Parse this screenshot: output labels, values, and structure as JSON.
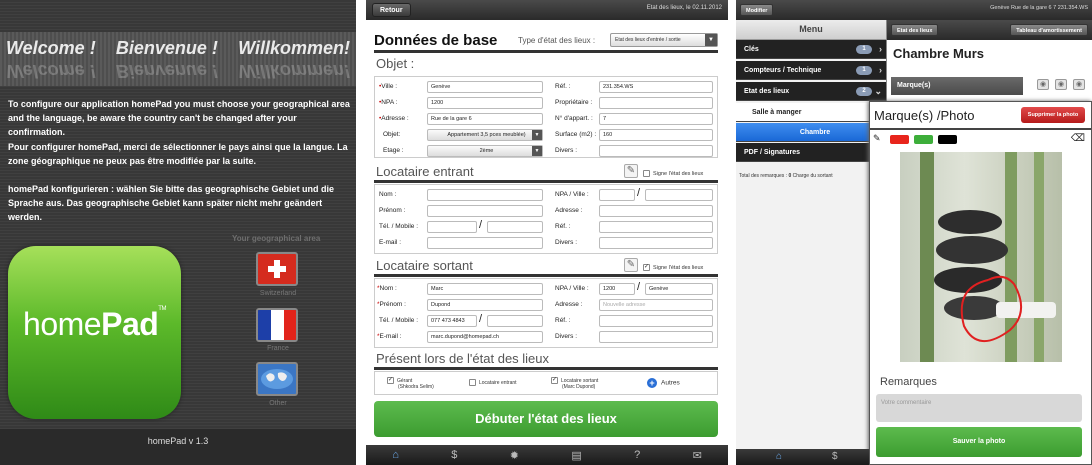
{
  "screen1": {
    "welcome": [
      "Welcome !",
      "Bienvenue !",
      "Willkommen!"
    ],
    "intro_en": "To configure our application homePad you must choose your geographical area and the language, be aware the country can't be changed after your confirmation.",
    "intro_fr": "Pour configurer homePad, merci de sélectionner le pays ainsi que la langue. La zone géographique ne peux pas être modifiée par la suite.",
    "intro_de": "homePad konfigurieren : wählen Sie bitte das geographische Gebiet und die Sprache aus. Das geographische Gebiet kann später nicht mehr geändert werden.",
    "geo_title": "Your geographical area",
    "logo": {
      "home": "home",
      "pad": "Pad",
      "tm": "TM"
    },
    "countries": [
      {
        "label": "Switzerland",
        "icon": "swiss-flag-icon"
      },
      {
        "label": "France",
        "icon": "french-flag-icon"
      },
      {
        "label": "Other",
        "icon": "world-map-icon"
      }
    ],
    "version": "homePad v 1.3"
  },
  "screen2": {
    "back": "Retour",
    "header_right": "Etat des lieux, le 02.11.2012",
    "title": "Données de base",
    "type_label": "Type d'état des lieux :",
    "type_value": "Etat des lieux d'entrée / sortie",
    "objet_title": "Objet :",
    "objet": {
      "ville_label": "Ville :",
      "ville": "Genève",
      "ref_label": "Réf. :",
      "ref": "231.354.WS",
      "npa_label": "NPA :",
      "npa": "1200",
      "proprio_label": "Propriétaire :",
      "proprio": "",
      "adresse_label": "Adresse :",
      "adresse": "Rue de la gare 6",
      "appart_label": "N° d'appart. :",
      "appart": "7",
      "objet_label": "Objet:",
      "objet": "Appartement 3,5 pces meublée)",
      "surface_label": "Surface (m2) :",
      "surface": "160",
      "etage_label": "Etage :",
      "etage": "2ème",
      "divers_label": "Divers :",
      "divers": ""
    },
    "entrant_title": "Locataire entrant",
    "sign_label": "Signe l'état des lieux",
    "fields_left": [
      "Nom :",
      "Prénom :",
      "Tél. / Mobile :",
      "E-mail :"
    ],
    "fields_right": [
      "NPA / Ville :",
      "Adresse :",
      "Réf. :",
      "Divers :"
    ],
    "sortant_title": "Locataire sortant",
    "sortant": {
      "nom": "Marc",
      "prenom": "Dupond",
      "tel": "077 473 4843",
      "email": "marc.dupond@homepad.ch",
      "npa": "1200",
      "ville": "Genève",
      "adresse_ph": "Nouvelle adresse"
    },
    "present_title": "Présent lors de l'état des lieux",
    "present": [
      {
        "label": "Gérant",
        "sub": "(Shkodra Selim)",
        "checked": "✓"
      },
      {
        "label": "Locataire entrant",
        "sub": "",
        "checked": ""
      },
      {
        "label": "Locataire sortant",
        "sub": "(Marc Dupond)",
        "checked": "✓"
      }
    ],
    "autres": "Autres",
    "start": "Débuter l'état des lieux",
    "tabs": [
      "home-icon",
      "dollar-icon",
      "gear-icon",
      "document-icon",
      "help-icon",
      "mail-icon"
    ]
  },
  "screen3": {
    "modifier": "Modifier",
    "menu": "Menu",
    "header_right": "Genève Rue de la gare 6 7 231.354.WS",
    "etat_btn": "Etat des lieux",
    "tableau_btn": "Tableau d'amortissement",
    "items": [
      {
        "label": "Clés",
        "badge": "1"
      },
      {
        "label": "Compteurs / Technique",
        "badge": "1"
      },
      {
        "label": "Etat des lieux",
        "badge": "2"
      }
    ],
    "subitems": [
      "Salle à manger",
      "Chambre"
    ],
    "pdf": "PDF / Signatures",
    "total_label": "Total des remarques :",
    "total_value": "0",
    "total_rest": "Charge du sortant",
    "room": "Chambre  Murs",
    "marques": "Marque(s)",
    "modal_title": "Marque(s) /Photo",
    "delete": "Supprimer la photo",
    "colors": [
      "#e8251c",
      "#3dae3a",
      "#000000"
    ],
    "remarques": "Remarques",
    "comment_ph": "Votre commentaire",
    "save": "Sauver la photo"
  }
}
